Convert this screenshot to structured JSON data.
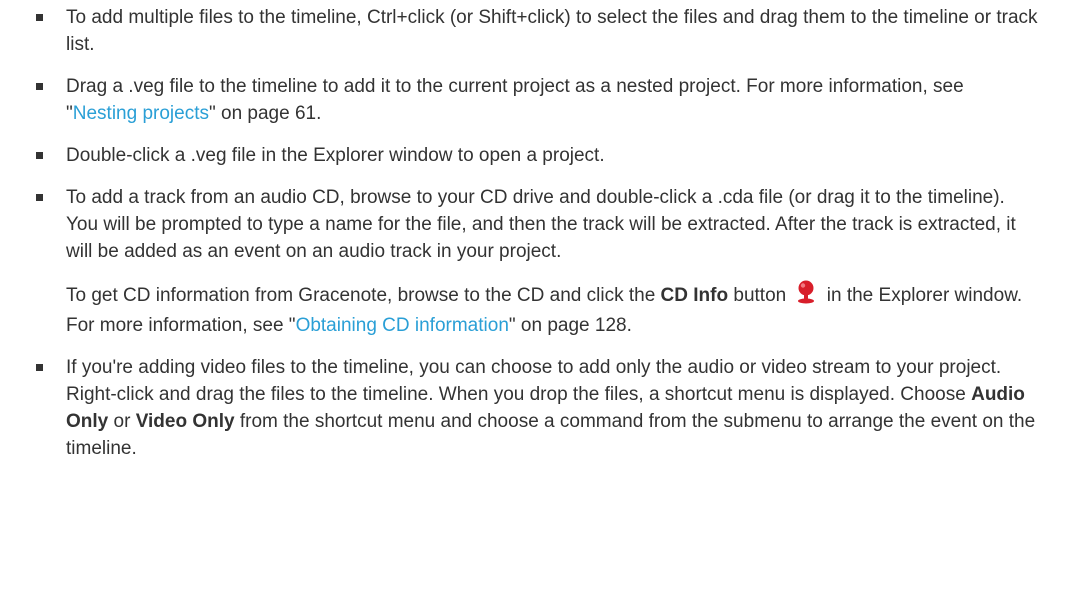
{
  "items": [
    {
      "text": "To add multiple files to the timeline, Ctrl+click (or Shift+click) to select the files and drag them to the timeline or track list."
    },
    {
      "pre": "Drag a .veg file to the timeline to add it to the current project as a nested project. For more information, see \"",
      "link": "Nesting projects",
      "post": "\" on page 61."
    },
    {
      "text": "Double-click a .veg file in the Explorer window to open a project."
    },
    {
      "text": "To add a track from an audio CD, browse to your CD drive and double-click a .cda file (or drag it to the timeline). You will be prompted to type a name for the file, and then the track will be extracted. After the track is extracted, it will be added as an event on an audio track in your project.",
      "p2_pre": "To get CD information from Gracenote, browse to the CD and click the ",
      "p2_bold": "CD Info",
      "p2_mid": " button ",
      "p2_after_icon": " in the Explorer window. For more information, see \"",
      "p2_link": "Obtaining CD information",
      "p2_post": "\" on page 128."
    },
    {
      "pre": "If you're adding video files to the timeline, you can choose to add only the audio or video stream to your project. Right-click and drag the files to the timeline. When you drop the files, a shortcut menu is displayed. Choose ",
      "bold1": "Audio Only",
      "mid": " or ",
      "bold2": "Video Only",
      "post": " from the shortcut menu and choose a command from the submenu to arrange the event on the timeline."
    }
  ],
  "colors": {
    "text": "#333333",
    "link": "#2a9fd6",
    "cd_icon": "#d81e2a"
  },
  "icons": {
    "bullet": "square-bullet-icon",
    "cd_info": "cd-info-icon"
  }
}
